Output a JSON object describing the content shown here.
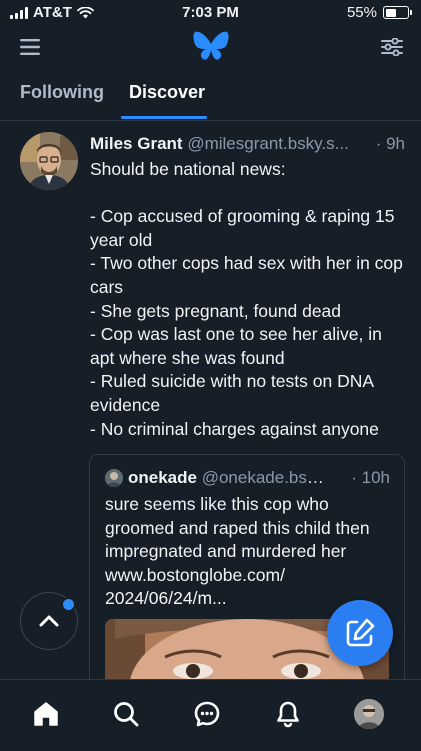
{
  "status_bar": {
    "carrier": "AT&T",
    "time": "7:03 PM",
    "battery_percent": "55%",
    "battery_level": 0.55
  },
  "header": {
    "menu_icon": "hamburger-icon",
    "logo_icon": "butterfly-logo-icon",
    "settings_icon": "sliders-icon"
  },
  "tabs": [
    {
      "label": "Following",
      "active": false
    },
    {
      "label": "Discover",
      "active": true
    }
  ],
  "post": {
    "author_name": "Miles Grant",
    "author_handle": "@milesgrant.bsky.s...",
    "time": "· 9h",
    "lines": [
      "Should be national news:",
      "",
      "- Cop accused of grooming & raping 15 year old",
      "- Two other cops had sex with her in cop cars",
      "- She gets pregnant, found dead",
      "- Cop was last one to see her alive, in apt where she was found",
      "- Ruled suicide with no tests on DNA evidence",
      "- No criminal charges against anyone"
    ],
    "quote": {
      "author_name": "onekade",
      "author_handle": "@onekade.bsky...",
      "time": "· 10h",
      "text": "sure seems like this cop who groomed and raped this child then impregnated and murdered her www.bostonglobe.com/ 2024/06/24/m..."
    }
  },
  "bottom_nav": [
    {
      "name": "home",
      "icon": "home-icon",
      "active": true
    },
    {
      "name": "search",
      "icon": "search-icon"
    },
    {
      "name": "chat",
      "icon": "chat-bubble-icon"
    },
    {
      "name": "notifications",
      "icon": "bell-icon"
    },
    {
      "name": "profile",
      "icon": "profile-avatar"
    }
  ],
  "colors": {
    "background": "#161e27",
    "accent": "#2b8cff",
    "compose_button": "#2b7ef1",
    "muted_text": "#8a99a8"
  }
}
